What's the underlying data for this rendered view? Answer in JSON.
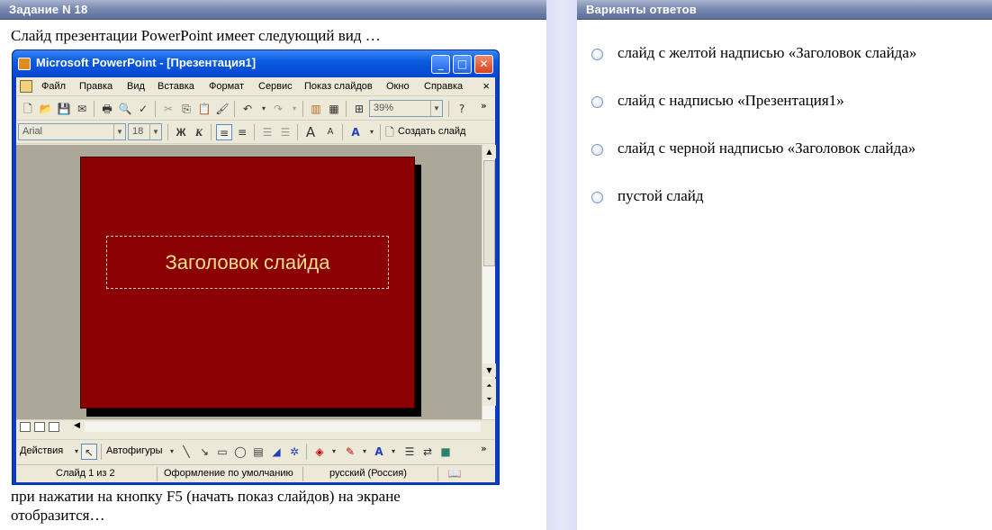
{
  "left_panel": {
    "header": "Задание N 18",
    "question_intro": "Слайд презентации PowerPoint имеет следующий вид …",
    "question_tail_line1": "при нажатии на кнопку F5 (начать показ слайдов) на экране",
    "question_tail_line2": "отобразится…"
  },
  "right_panel": {
    "header": "Варианты ответов",
    "answers": [
      {
        "label": "слайд с желтой надписью «Заголовок слайда»"
      },
      {
        "label": "слайд с надписью «Презентация1»"
      },
      {
        "label": "слайд с черной надписью «Заголовок слайда»"
      },
      {
        "label": "пустой слайд"
      }
    ]
  },
  "ppt_window": {
    "title": "Microsoft PowerPoint - [Презентация1]",
    "menu": [
      "Файл",
      "Правка",
      "Вид",
      "Вставка",
      "Формат",
      "Сервис",
      "Показ слайдов",
      "Окно",
      "Справка"
    ],
    "menu_close": "×",
    "zoom": "39%",
    "font_name": "Arial",
    "font_size": "18",
    "bold_label": "Ж",
    "italic_label": "К",
    "create_slide_label": "Создать слайд",
    "slide_title_text": "Заголовок слайда",
    "slide_color": "#8b0000",
    "slide_title_color": "#ffe08a",
    "drawbar_actions": "Действия",
    "drawbar_autoshapes": "Автофигуры",
    "status_slide": "Слайд 1 из 2",
    "status_design": "Оформление по умолчанию",
    "status_language": "русский (Россия)"
  }
}
